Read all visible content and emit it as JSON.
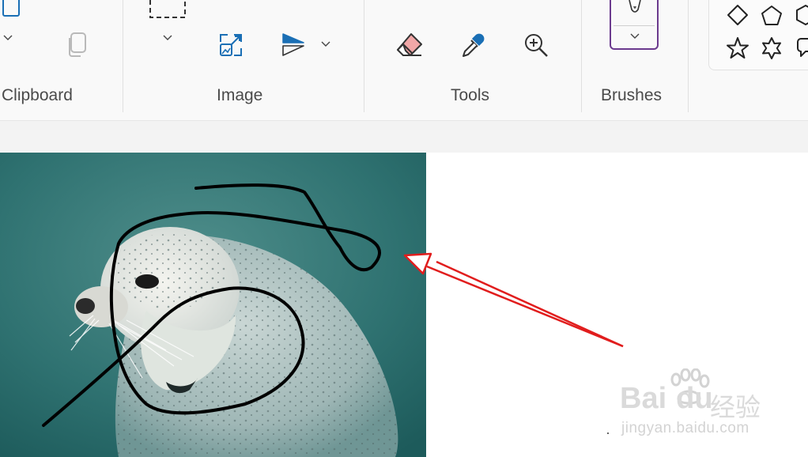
{
  "ribbon": {
    "groups": [
      {
        "label": "Clipboard"
      },
      {
        "label": "Image"
      },
      {
        "label": "Tools"
      },
      {
        "label": "Brushes"
      }
    ]
  },
  "icons": {
    "paste": "paste-icon",
    "clipboard_dropdown": "chevron-down-icon",
    "copy": "copy-icon",
    "select": "select-rectangle-icon",
    "select_dropdown": "chevron-down-icon",
    "resize": "resize-image-icon",
    "flip": "flip-rotate-icon",
    "flip_dropdown": "chevron-down-icon",
    "eraser": "eraser-icon",
    "color_picker": "color-picker-icon",
    "magnifier": "magnifier-icon",
    "brush": "brush-icon",
    "brush_dropdown": "chevron-down-icon",
    "shapes": [
      "diamond-icon",
      "pentagon-icon",
      "hexagon-icon",
      "star5-icon",
      "star6-icon",
      "callout-icon"
    ]
  },
  "canvas": {
    "annotation_color": "#e11d1d",
    "stroke_color": "#000000"
  },
  "watermark": {
    "brand": "Bai",
    "brand2": "du",
    "cn": "经验",
    "url": "jingyan.baidu.com"
  }
}
